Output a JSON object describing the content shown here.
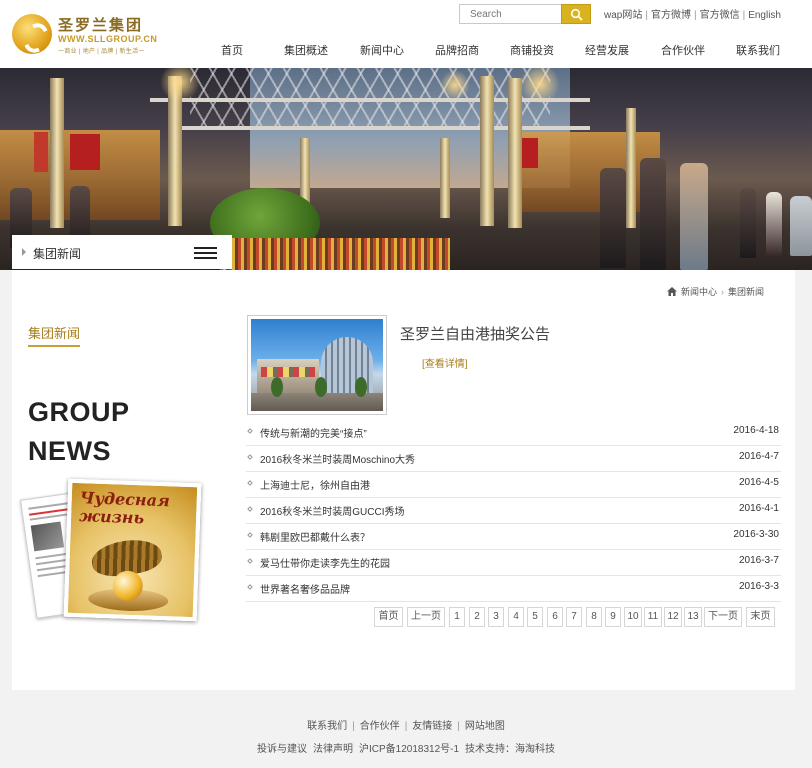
{
  "header": {
    "logo_cn": "圣罗兰集团",
    "logo_en": "WWW.SLLGROUP.CN",
    "logo_tag": "一商业 | 地产 | 品牌 | 新生活一",
    "search_placeholder": "Search",
    "top_links": [
      "wap网站",
      "官方微博",
      "官方微信",
      "English"
    ],
    "nav": [
      "首页",
      "集团概述",
      "新闻中心",
      "品牌招商",
      "商铺投资",
      "经营发展",
      "合作伙伴",
      "联系我们"
    ]
  },
  "banner": {
    "section_label": "集团新闻"
  },
  "breadcrumb": {
    "items": [
      "新闻中心",
      "集团新闻"
    ]
  },
  "sidebar": {
    "title": "集团新闻",
    "big_line1": "GROUP",
    "big_line2": "NEWS",
    "magazine_title_line1": "Чудесная",
    "magazine_title_line2": "жизнь"
  },
  "featured": {
    "title": "圣罗兰自由港抽奖公告",
    "more": "[查看详情]"
  },
  "news": [
    {
      "title": "传统与新潮的完美“接点”",
      "date": "2016-4-18"
    },
    {
      "title": "2016秋冬米兰时装周Moschino大秀",
      "date": "2016-4-7"
    },
    {
      "title": "上海迪士尼，徐州自由港",
      "date": "2016-4-5"
    },
    {
      "title": "2016秋冬米兰时装周GUCCI秀场",
      "date": "2016-4-1"
    },
    {
      "title": "韩剧里欧巴都戴什么表？",
      "date": "2016-3-30"
    },
    {
      "title": "爱马仕带你走读李先生的花园",
      "date": "2016-3-7"
    },
    {
      "title": "世界著名奢侈品品牌",
      "date": "2016-3-3"
    }
  ],
  "pager": {
    "first": "首页",
    "prev": "上一页",
    "pages": [
      "1",
      "2",
      "3",
      "4",
      "5",
      "6",
      "7",
      "8",
      "9",
      "10",
      "11",
      "12",
      "13"
    ],
    "next": "下一页",
    "last": "末页"
  },
  "footer": {
    "links": [
      "联系我们",
      "合作伙伴",
      "友情链接",
      "网站地图"
    ],
    "info": [
      "投诉与建议",
      "法律声明",
      "沪ICP备12018312号-1",
      "技术支持：海淘科技"
    ]
  },
  "colors": {
    "accent_gold": "#c9a035",
    "search_button": "#d9b21f"
  }
}
